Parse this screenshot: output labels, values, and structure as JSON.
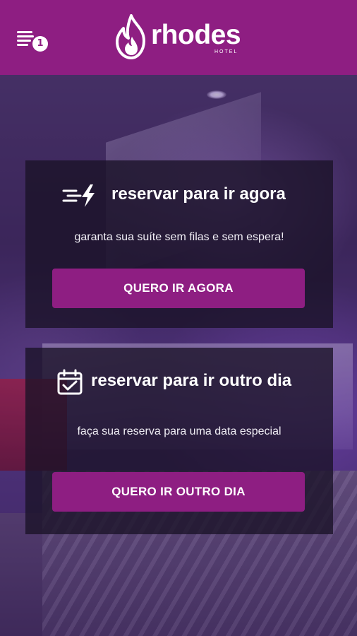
{
  "header": {
    "brand": "rhodes",
    "brand_sub": "HOTEL",
    "menu_badge": "1",
    "menu_icon": "menu-list-icon",
    "logo_icon": "flame-icon",
    "color": "#8e1e82"
  },
  "cards": [
    {
      "icon": "lightning-speed-icon",
      "title": "reservar para ir agora",
      "subtitle": "garanta sua suíte sem filas e sem espera!",
      "button_label": "QUERO IR AGORA"
    },
    {
      "icon": "calendar-check-icon",
      "title": "reservar para ir outro dia",
      "subtitle": "faça sua reserva para uma data especial",
      "button_label": "QUERO IR OUTRO DIA"
    }
  ],
  "colors": {
    "accent": "#8e1e82",
    "card_bg": "#19122699"
  }
}
